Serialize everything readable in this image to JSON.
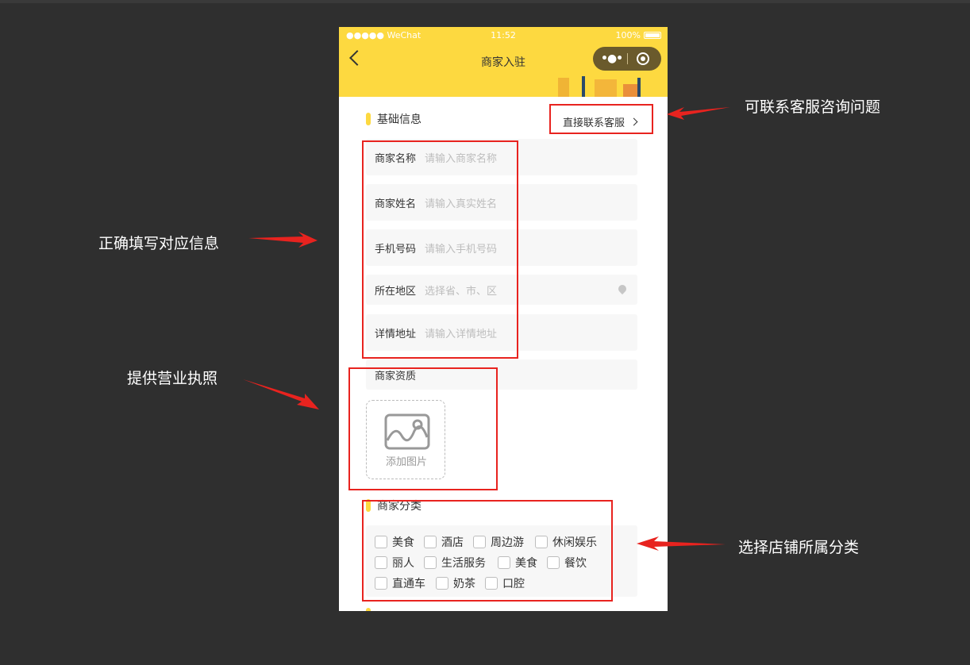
{
  "status": {
    "signal": "●●●●● WeChat",
    "time": "11:52",
    "battery": "100%"
  },
  "nav": {
    "title": "商家入驻",
    "capsule_dots": "•●•"
  },
  "basic": {
    "title": "基础信息",
    "contact": "直接联系客服"
  },
  "fields": [
    {
      "label": "商家名称",
      "placeholder": "请输入商家名称"
    },
    {
      "label": "商家姓名",
      "placeholder": "请输入真实姓名"
    },
    {
      "label": "手机号码",
      "placeholder": "请输入手机号码"
    },
    {
      "label": "所在地区",
      "placeholder": "选择省、市、区"
    },
    {
      "label": "详情地址",
      "placeholder": "请输入详情地址"
    }
  ],
  "qualification": {
    "label": "商家资质",
    "upload": "添加图片"
  },
  "category": {
    "title": "商家分类",
    "items": [
      "美食",
      "酒店",
      "周边游",
      "休闲娱乐",
      "丽人",
      "生活服务",
      "美食",
      "餐饮",
      "直通车",
      "奶茶",
      "口腔"
    ]
  },
  "notes": {
    "contact": "可联系客服咨询问题",
    "fill": "正确填写对应信息",
    "license": "提供营业执照",
    "category": "选择店铺所属分类"
  },
  "colors": {
    "accent": "#fdd940",
    "annotation": "#e8231f",
    "background": "#2f2f2f"
  }
}
